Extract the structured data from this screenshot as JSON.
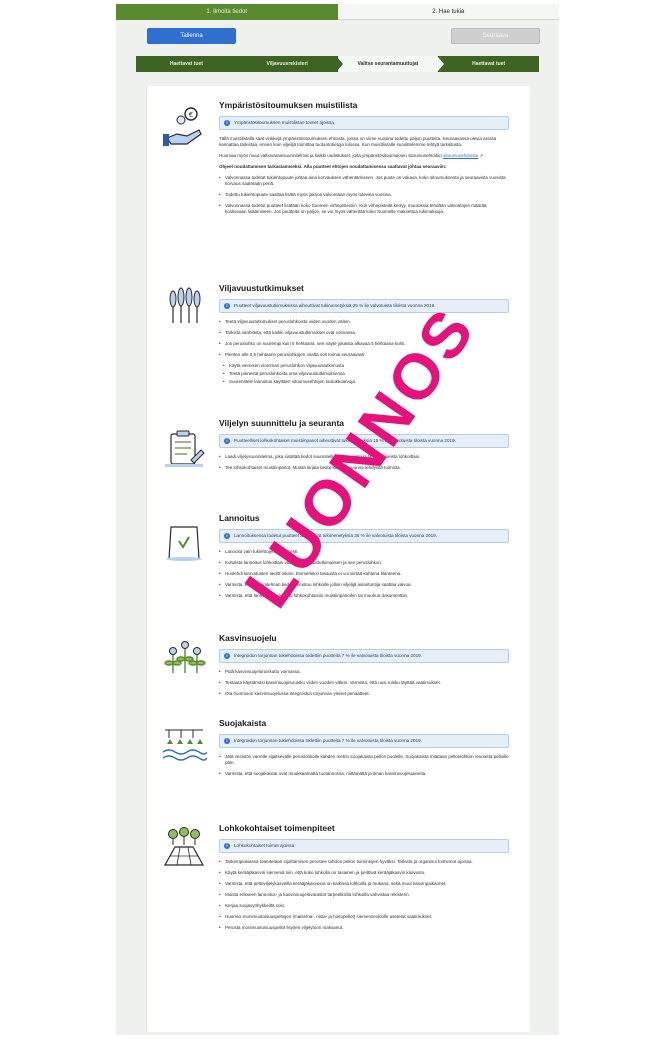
{
  "steps": [
    {
      "label": "1. Ilmoita tiedot"
    },
    {
      "label": "2. Hae tukia"
    }
  ],
  "buttons": {
    "primary": "Tallenna",
    "disabled": "Seuraava"
  },
  "phases": [
    {
      "label": "Haettavat tuet"
    },
    {
      "label": "Viljavuusrekisteri"
    },
    {
      "label": "Valitse seurantamuuttujat"
    },
    {
      "label": "Haettavat tuet"
    }
  ],
  "stamp": "LUONNOS",
  "sections": {
    "muistilista": {
      "title": "Ympäristösitoumuksen muistilista",
      "info": "Ympäristösitoumuksen muistilistan toimet ajoissa",
      "paras": [
        "Tällä muistilistalla saat vinkkejä ympäristösitoumuksen ehtoista, joissa on viime vuosina todettu paljon puutteita. Seuraavassa olevia asioita kannattaa tarkistaa, ennen kuin viljelijä toimittaa tuotantotietoja tulossa. Kun muistilistalle suosittelemme tehtyä tarkistusta.",
        "Huomaa myös muut valtiovarainsuunnitelmat ja kaikki uudistukset, joita ympäristösitoumuksen sitoumusehtoihin"
      ],
      "link": "sitoumusehdoista",
      "para3": "Ohjeet noudattamisen tarkastamiseksi. Alla puutteet ehtojen noudattamisessa saattavat johtaa seuraaviin:",
      "bullets": [
        "Valvonnassa todetut tukiehtopuute johtaa aina korvauksen vähentämiseen. Jos puute on vakava, koko sitoumuksesta ja seuraavista vuosista korvaus saatetaan periä.",
        "Todettu tukiehtopuute saattaa lisätä myös jaksoa valvontaan myös tulevina vuosina.",
        "Valvonnassa todetut puutteet lisätään koko Suomen virhepisteisiin. Kun virhepisteitä kertyy, muutoksia tehdään valvontojen määrää koskevaan lisäämiseen. Jos puutteita on paljon, se voi myös vähentää koko Suomelle maksettua tukimaksuja."
      ]
    },
    "viljavuus": {
      "title": "Viljavuustutkimukset",
      "info": "Puutteet viljavuustutkimuksissa aiheuttivat tukimenetyksiä 25 % ile valvotuista tiloista vuonna 2019.",
      "bullets": [
        "Teetä viljavuustutkimukset peruslohkoista viiden vuoden välein.",
        "Tarkista vanhiteita, että kaikki viljavuustutkimukset ovat voimassa.",
        "Jos peruslohko on suurempi kuin 5 hehtaaria, sen näyte jokaista alkavaa 5 hehtaaria kohti.",
        "Pienten alle 0,5 hehtaarin peruslohkojen osalta voit toimia seuraavasti:"
      ],
      "sub": [
        "Käytä viereisen isomman peruslohkon viljavuustutkimusta",
        "Teetä pienestä peruslohkosta oma viljavuustutkimuksensa",
        "Suurenittele lannoitus käyttäen sitoumusehtojen taulukkoarvoja."
      ]
    },
    "suunnittelu": {
      "title": "Viljelyn suunnittelu ja seuranta",
      "info": "Puutteelliset lohkokohtaiset muistiinpanot aiheuttivat tukimenetyksiä 15 % ile valvotuista tiloista vuonna 2019.",
      "bullets": [
        "Laadi viljelysuunnitelma, joka sisältää tiedot suunnitelluista kasveista ja lannoitukseista lohkoittain.",
        "Tee lohkokohtaiset muistiinpanot. Muista kirjata tiedot kaikista vuonna tehdyistä toimista."
      ]
    },
    "lannoitus": {
      "title": "Lannoitus",
      "info": "Lannoituksessa todetut puutteet aiheuttivat tukimenetyksiä 36 % ile valvotuista tiloista vuonna 2019.",
      "bullets": [
        "Lannoita vain tukiehtojen mukaisesti.",
        "Kohdista lannoitus lohkoittain vuoden viljavuustutkimuksen ja sen peruslohkon.",
        "Huolehdi lannoitusten tiedot oikein. Esimerkiksi tasausta ei voi siirtää kahtena tilanteena.",
        "Varmista, että suunnitelman tiedot perustuu lohkoille jolloin viljelijä asiantuntija saattaa valvoa.",
        "Varmista, että lannoitus on kirjattu lohkokohtaisiin muistiinpanoihin tai muuhun dokumenttiin."
      ]
    },
    "kasvinsuojelu": {
      "title": "Kasvinsuojelu",
      "info": "Integroidun torjunnan tukiehdoissa todettiin puutteita 7 % ile valvotuista tiloista vuonna 2019.",
      "bullets": [
        "Pidä kasvinsuojeluruiskutto voimassa.",
        "Testauta käyttämäsi kasvinsuojeluruisku viiden vuoden välein. Varmista, että uusi ruisku täyttää vaatimukset.",
        "Ota huomioon kasvinsuojelussa integroidun torjunnan yleiset periaatteet."
      ]
    },
    "suojakaista": {
      "title": "Suojakaista",
      "info": "Integroidun torjunnan tukiehdoissa todettiin puutteita 7 % ile valvotuista tiloista vuonna 2019.",
      "bullets": [
        "Jätä vesistön varrelle sijaitsevalle peruslohkolle kahden metrin suojakaista pellon puolelle. Suojakaista mitataan pellonlohkon reunasta pelloille päin.",
        "Varmista, että suojakaistat ovat muokkaamatta tuotannossa, niittämättä ja ilman kasvinsuojeluaineita."
      ]
    },
    "lohkokohtaiset": {
      "title": "Lohkokohtaiset toimenpiteet",
      "info": "Lohkokohtaiset toimet ajoissa",
      "bullets": [
        "Tarkempiasiassa toteutetaan sijoittamisen perustee tahdon pellon toimintojen hyväksi. Tarkista ja organisoi toiminnot ajoissa.",
        "Käytä kerääjäkasvin siemeniä niin, että koko lohkolla on tasainen ja peittävä kerääjäkasvin kasvusto.",
        "Varmista, että peltoviljelykasveilla kerääjäkasveina on kaikissa lohkoilla ja mukana, sekä muut kasvinpaikannet.",
        "Muista erikseen lannoitus- ja kasvinsuojeluvarastot tarpeellisilta lohkoilla vahvistaa rekisterin.",
        "Kerjaa suojavyöhykkeiltä solo.",
        "Huomioi monimuotoisuuspeltojen (maisema-, riista- ja hoitopellot) siemenseoksille asetetut vaatimukset.",
        "Perusta monimuotoisuuspellot lisyiten viljelytoon maksanut."
      ]
    }
  }
}
